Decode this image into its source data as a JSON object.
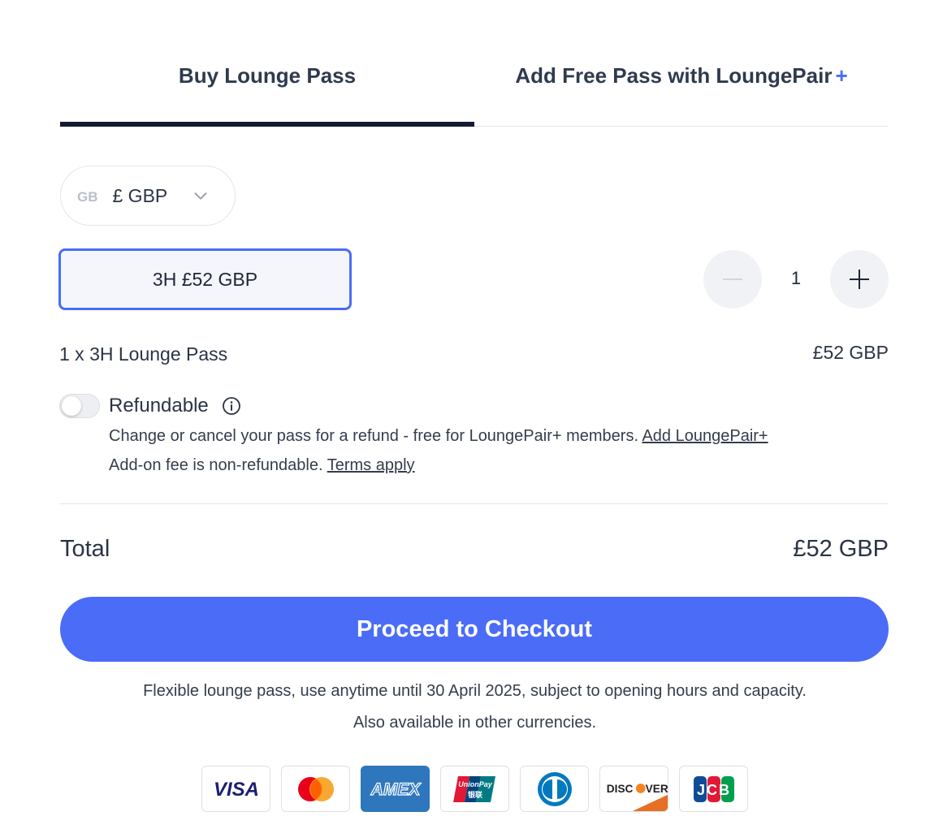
{
  "tabs": [
    {
      "label": "Buy Lounge Pass",
      "active": true
    },
    {
      "label": "Add Free Pass with LoungePair",
      "accent": "+",
      "active": false
    }
  ],
  "currency": {
    "flag_code": "GB",
    "label": "£ GBP",
    "icon": "chevron-down-icon"
  },
  "pass_option": {
    "label": "3H £52 GBP",
    "selected": true
  },
  "quantity": {
    "value": "1",
    "minus_icon": "minus-icon",
    "plus_icon": "plus-icon"
  },
  "line_item": {
    "label": "1 x 3H Lounge Pass",
    "price": "£52 GBP"
  },
  "refundable": {
    "label": "Refundable",
    "enabled": false,
    "icon": "info-icon",
    "description": "Change or cancel your pass for a refund - free for LoungePair+ members.",
    "add_link": "Add LoungePair+",
    "fee_note": "Add-on fee is non-refundable.",
    "terms_link": "Terms apply"
  },
  "total": {
    "label": "Total",
    "value": "£52 GBP"
  },
  "checkout": {
    "label": "Proceed to Checkout"
  },
  "notes": {
    "flexible": "Flexible lounge pass, use anytime until 30 April 2025, subject to opening hours and capacity.",
    "currencies": "Also available in other currencies."
  },
  "payment_methods": [
    {
      "name": "visa-logo",
      "label": "VISA"
    },
    {
      "name": "mastercard-logo",
      "label": ""
    },
    {
      "name": "amex-logo",
      "label": "AMEX"
    },
    {
      "name": "unionpay-logo",
      "label": "UnionPay"
    },
    {
      "name": "diners-logo",
      "label": ""
    },
    {
      "name": "discover-logo",
      "label": "DISC",
      "label_tail": "VER"
    },
    {
      "name": "jcb-logo",
      "label": "JCB"
    }
  ],
  "colors": {
    "accent": "#4a6cf7",
    "tab_underline": "#141b33",
    "text": "#2b3445"
  }
}
